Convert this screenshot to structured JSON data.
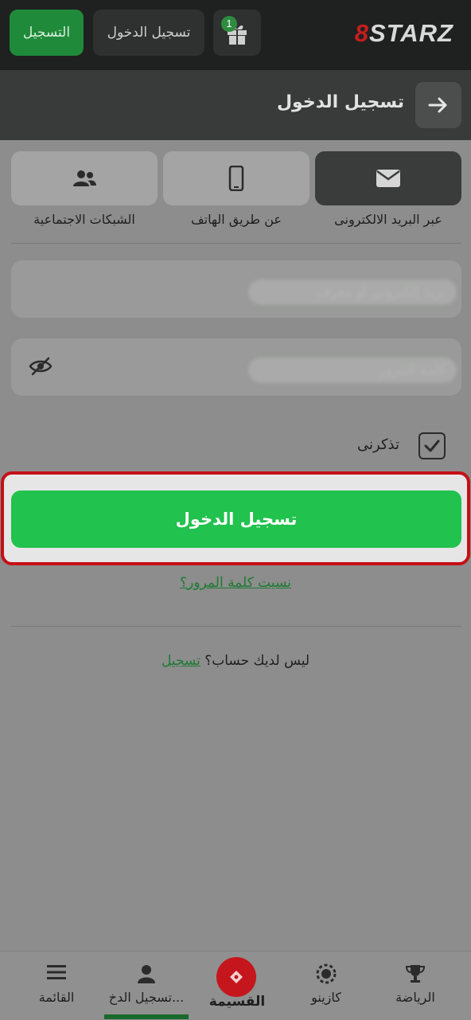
{
  "header": {
    "logo_prefix": "8",
    "logo_text": "STARZ",
    "gift_badge": "1",
    "login_label": "تسجيل الدخول",
    "register_label": "التسجيل"
  },
  "subheader": {
    "title": "تسجيل الدخول"
  },
  "methods": [
    {
      "label": "عبر البريد الالكترونى",
      "icon": "envelope-icon",
      "active": true
    },
    {
      "label": "عن طريق الهاتف",
      "icon": "phone-icon",
      "active": false
    },
    {
      "label": "الشبكات الاجتماعية",
      "icon": "users-icon",
      "active": false
    }
  ],
  "form": {
    "email_value": "بريد إلكتروني أو معرف",
    "password_value": "كلمة المرور",
    "remember_label": "تذكرنى",
    "remember_checked": true,
    "submit_label": "تسجيل الدخول",
    "forgot_label": "نسيت كلمة المرور؟",
    "no_account_text": "ليس لديك حساب؟",
    "register_link": "تسجيل"
  },
  "bottom_nav": [
    {
      "label": "الرياضة",
      "icon": "trophy-icon"
    },
    {
      "label": "كازينو",
      "icon": "casino-chip-icon"
    },
    {
      "label": "القسيمة",
      "icon": "ticket-icon"
    },
    {
      "label": "تسجيل الدخ...",
      "icon": "user-icon"
    },
    {
      "label": "القائمة",
      "icon": "menu-icon"
    }
  ],
  "colors": {
    "accent_green": "#21c24d",
    "highlight_red": "#c41017",
    "brand_red": "#c4161c"
  }
}
